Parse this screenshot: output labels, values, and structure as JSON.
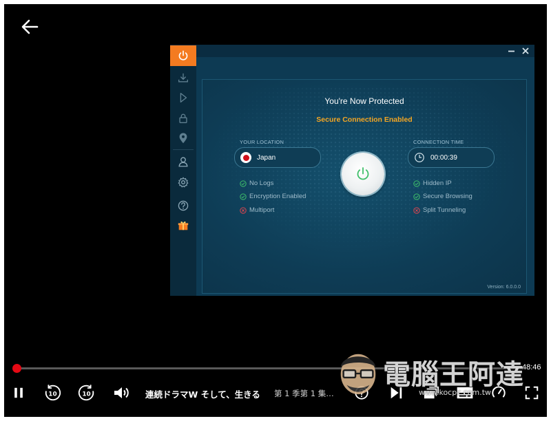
{
  "player": {
    "progress_fraction": 0.005,
    "time_remaining": "48:46",
    "title": "連続ドラマW そして、生きる",
    "episode": "第 1 季第 1 集…",
    "colors": {
      "accent": "#e50914",
      "background": "#000000"
    }
  },
  "vpn": {
    "title": "You're Now Protected",
    "status": "Secure Connection Enabled",
    "location_label": "YOUR LOCATION",
    "location_value": "Japan",
    "time_label": "CONNECTION TIME",
    "time_value": "00:00:39",
    "features_left": [
      {
        "label": "No Logs",
        "state": "check"
      },
      {
        "label": "Encryption Enabled",
        "state": "check"
      },
      {
        "label": "Multiport",
        "state": "cross"
      }
    ],
    "features_right": [
      {
        "label": "Hidden IP",
        "state": "check"
      },
      {
        "label": "Secure Browsing",
        "state": "check"
      },
      {
        "label": "Split Tunneling",
        "state": "cross"
      }
    ],
    "version": "Version: 6.0.0.0",
    "colors": {
      "accent": "#f47b20",
      "status": "#f5a623",
      "check": "#3fbf6a",
      "cross": "#e0454f"
    }
  },
  "watermark": {
    "text": "電腦王阿達",
    "url": "www.kocpc.com.tw"
  },
  "icons": [
    "back-arrow-icon",
    "power-icon",
    "download-icon",
    "play-icon",
    "lock-icon",
    "location-icon",
    "user-icon",
    "gear-icon",
    "help-icon",
    "gift-icon",
    "minimize-icon",
    "close-icon",
    "clock-icon",
    "pause-icon",
    "rewind-10-icon",
    "forward-10-icon",
    "volume-icon",
    "next-episode-icon",
    "episodes-icon",
    "subtitles-icon",
    "speed-icon",
    "fullscreen-icon"
  ]
}
